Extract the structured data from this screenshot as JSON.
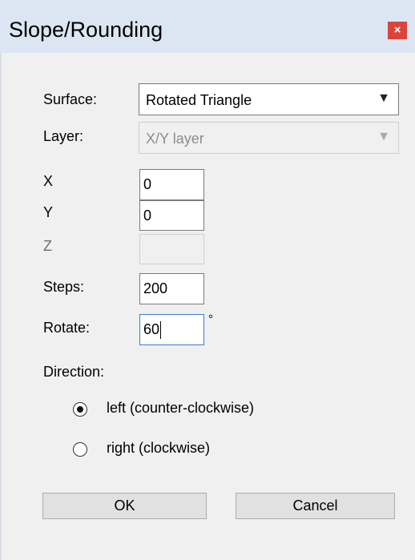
{
  "window": {
    "title": "Slope/Rounding",
    "close_glyph": "×"
  },
  "form": {
    "surface": {
      "label": "Surface:",
      "value": "Rotated Triangle"
    },
    "layer": {
      "label": "Layer:",
      "value": "X/Y layer"
    },
    "x": {
      "label": "X",
      "value": "0"
    },
    "y": {
      "label": "Y",
      "value": "0"
    },
    "z": {
      "label": "Z",
      "value": ""
    },
    "steps": {
      "label": "Steps:",
      "value": "200"
    },
    "rotate": {
      "label": "Rotate:",
      "value": "60",
      "unit": "°"
    },
    "direction": {
      "label": "Direction:",
      "options": [
        {
          "label": "left (counter-clockwise)",
          "selected": true
        },
        {
          "label": "right (clockwise)",
          "selected": false
        }
      ]
    }
  },
  "buttons": {
    "ok": "OK",
    "cancel": "Cancel"
  },
  "icons": {
    "dropdown": "chevron-down-icon",
    "close": "close-icon"
  }
}
